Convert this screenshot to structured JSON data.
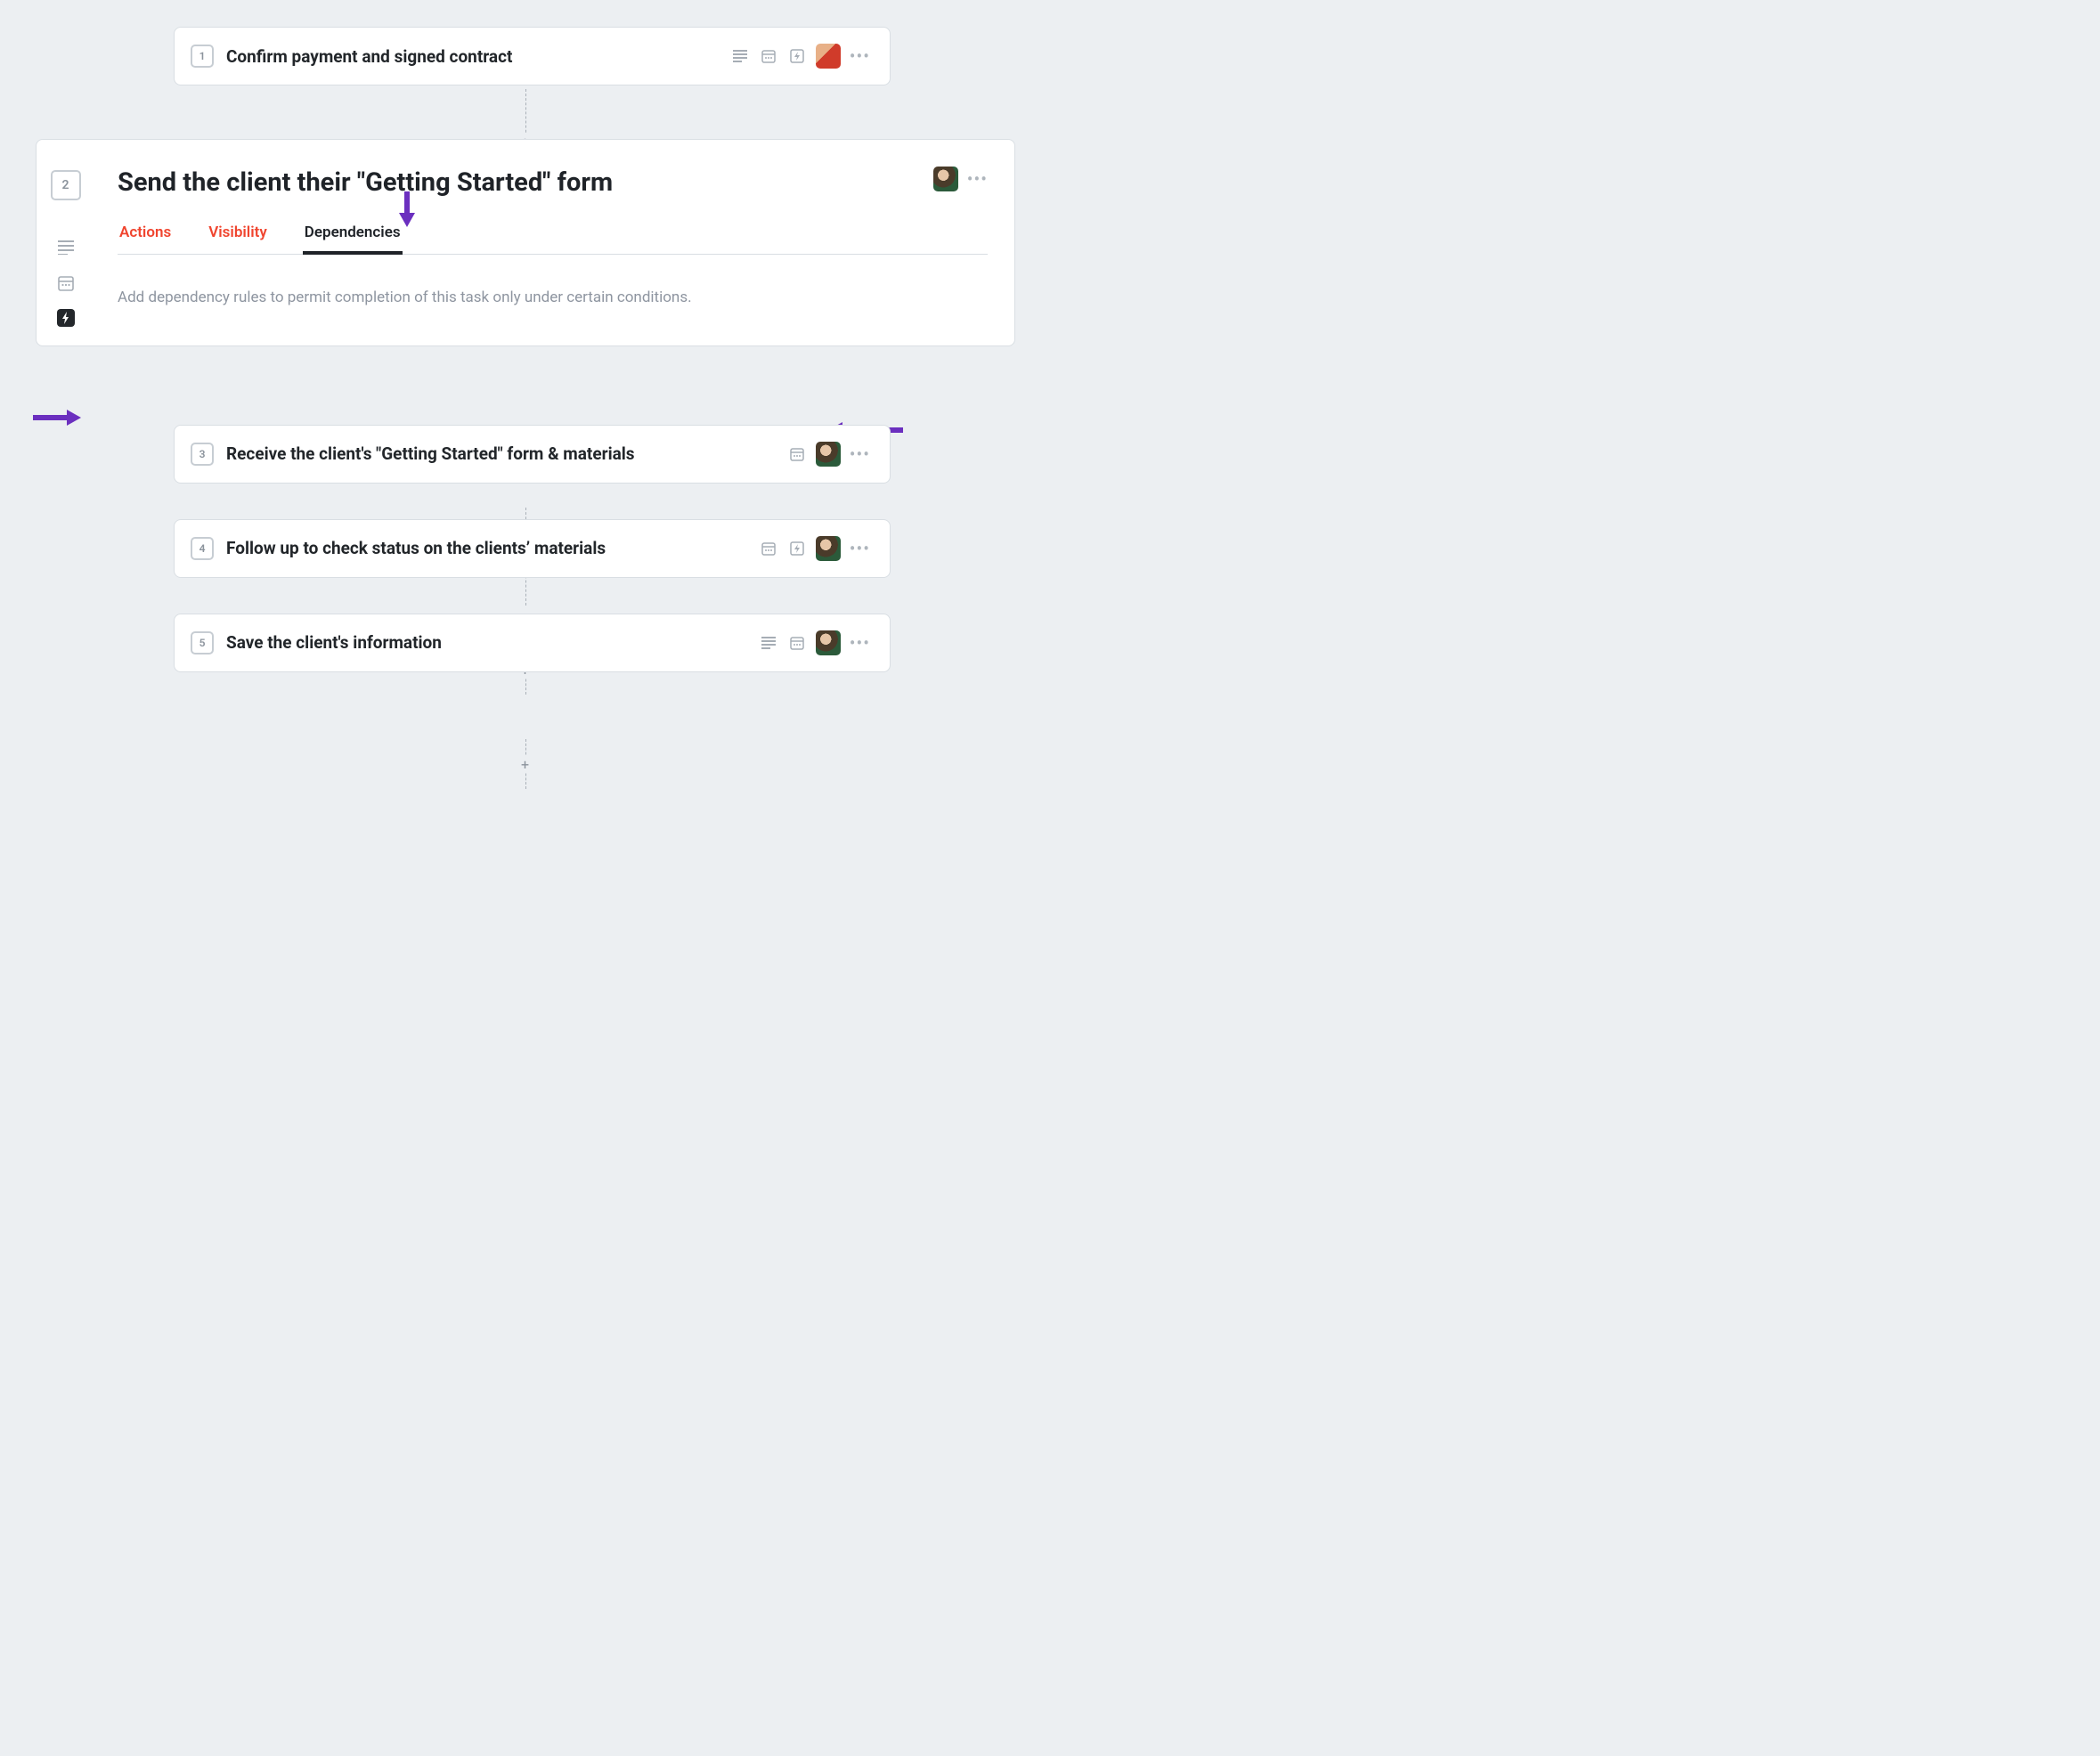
{
  "tasks": [
    {
      "num": "1",
      "title": "Confirm payment and signed contract",
      "icons": {
        "lines": true,
        "calendar": true,
        "bolt": true
      },
      "avatar": "man"
    },
    {
      "num": "3",
      "title": "Receive the client's \"Getting Started\" form & materials",
      "icons": {
        "lines": false,
        "calendar": true,
        "bolt": false
      },
      "avatar": "kid"
    },
    {
      "num": "4",
      "title": "Follow up to check status on the clients’ materials",
      "icons": {
        "lines": false,
        "calendar": true,
        "bolt": true
      },
      "avatar": "kid"
    },
    {
      "num": "5",
      "title": "Save the client's information",
      "icons": {
        "lines": true,
        "calendar": true,
        "bolt": false
      },
      "avatar": "kid"
    }
  ],
  "expanded": {
    "num": "2",
    "title": "Send the client their \"Getting Started\" form",
    "tabs": {
      "actions": "Actions",
      "visibility": "Visibility",
      "dependencies": "Dependencies"
    },
    "hint": "Add dependency rules to permit completion of this task only under certain conditions.",
    "avatar": "kid"
  }
}
